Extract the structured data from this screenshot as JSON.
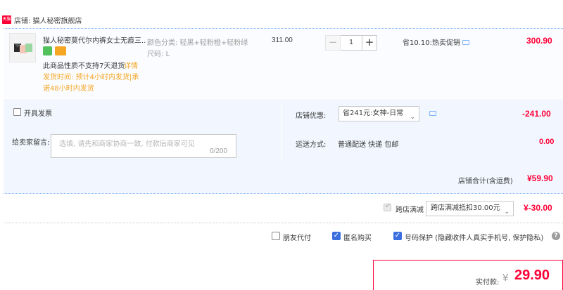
{
  "shop": {
    "icon_text": "天猫",
    "label": "店铺: 猫人秘密旗舰店"
  },
  "item": {
    "title": "猫人秘密莫代尔内裤女士无痕三...",
    "sku_color": "颜色分类: 轻黑+轻粉橙+轻粉绿",
    "sku_size": "尺码: L",
    "return_note": "此商品性质不支持7天退货",
    "return_detail": "详情",
    "ship_line1": "发货时间: 预计4小时内发货|承",
    "ship_line2": "诺48小时内发货",
    "unit_price": "311.00",
    "quantity": "1",
    "minus_symbol": "−",
    "plus_symbol": "+",
    "promo": "省10.10:热卖促销",
    "total": "300.90"
  },
  "invoice": {
    "label": "开具发票"
  },
  "shop_discount": {
    "label": "店铺优惠:",
    "selected": "省241元:女神-日常",
    "amount": "-241.00"
  },
  "message": {
    "label": "给卖家留言:",
    "placeholder": "选填, 请先和商家协商一致, 付款后商家可见",
    "counter": "0/200"
  },
  "shipping": {
    "label": "运送方式:",
    "value": "普通配送 快递 包邮",
    "fee": "0.00"
  },
  "store_total": {
    "label": "店铺合计(含运费)",
    "amount": "¥59.90"
  },
  "cross_store": {
    "label": "跨店满减",
    "selected": "跨店满减抵扣30.00元",
    "amount": "¥-30.00"
  },
  "options": {
    "friend_pay": "朋友代付",
    "anonymous": "匿名购买",
    "privacy": "号码保护 (隐藏收件人真实手机号, 保护隐私)",
    "check_mark": "✓",
    "help": "?"
  },
  "payment": {
    "label": "实付款:",
    "currency": "¥",
    "amount": "29.90"
  },
  "colors": {
    "accent_red": "#ff0036",
    "panel_blue": "#f2f7ff",
    "checkbox_blue": "#3b6fe0",
    "note_orange": "#f5a623"
  }
}
